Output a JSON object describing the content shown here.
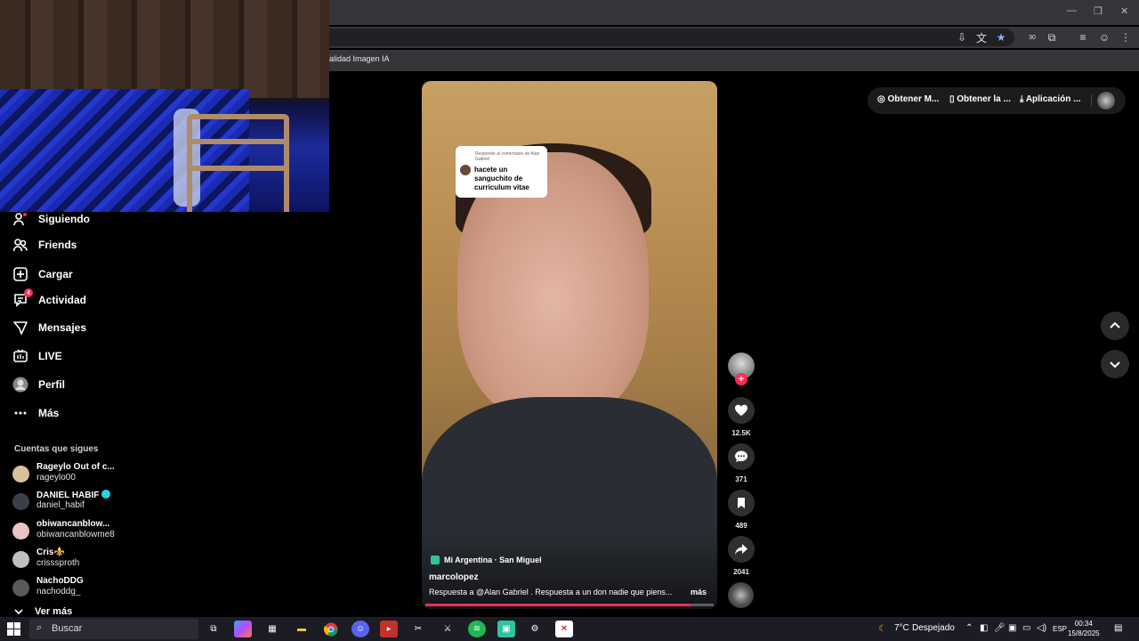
{
  "browser": {
    "bookmark_label": "alidad Imagen IA",
    "ext_count": "30"
  },
  "sidebar": {
    "items": [
      {
        "label": "Siguiendo",
        "icon": "following-icon"
      },
      {
        "label": "Friends",
        "icon": "friends-icon"
      },
      {
        "label": "Cargar",
        "icon": "upload-icon"
      },
      {
        "label": "Actividad",
        "icon": "activity-icon",
        "badge": "4"
      },
      {
        "label": "Mensajes",
        "icon": "messages-icon"
      },
      {
        "label": "LIVE",
        "icon": "live-icon"
      },
      {
        "label": "Perfil",
        "icon": "profile-icon"
      },
      {
        "label": "Más",
        "icon": "more-icon"
      }
    ],
    "following_title": "Cuentas que sigues",
    "accounts": [
      {
        "name": "Rageylo Out of c...",
        "handle": "rageylo00",
        "color": "#d9c29a"
      },
      {
        "name": "DANIEL HABIF",
        "handle": "daniel_habif",
        "color": "#3a3f4a",
        "verified": true
      },
      {
        "name": "obiwancanblow...",
        "handle": "obiwancanblowme8",
        "color": "#e8c4c4"
      },
      {
        "name": "Cris⚜️",
        "handle": "crisssproth",
        "color": "#bfbfbf"
      },
      {
        "name": "NachoDDG",
        "handle": "nachoddg_",
        "color": "#5a5a5a"
      }
    ],
    "see_more": "Ver más"
  },
  "video": {
    "reply_header": "Responde al comentario de Alan Gabriel",
    "reply_text": "hacete un sanguchito de curriculum vitae",
    "location": "Mi Argentina · San Miguel",
    "author": "marcolopez",
    "description": "Respuesta a @Alan Gabriel . Respuesta a un don nadie que piens...",
    "more": "más",
    "progress": 0.92
  },
  "actions": {
    "likes": "12.5K",
    "comments": "371",
    "saves": "489",
    "shares": "2041"
  },
  "top_menu": {
    "item1": "Obtener M...",
    "item2": "Obtener la ...",
    "item3": "Aplicación ..."
  },
  "taskbar": {
    "search_placeholder": "Buscar",
    "weather_temp": "7°C",
    "weather_desc": "Despejado",
    "lang": "ESP",
    "time": "00:34",
    "date": "15/8/2025"
  }
}
